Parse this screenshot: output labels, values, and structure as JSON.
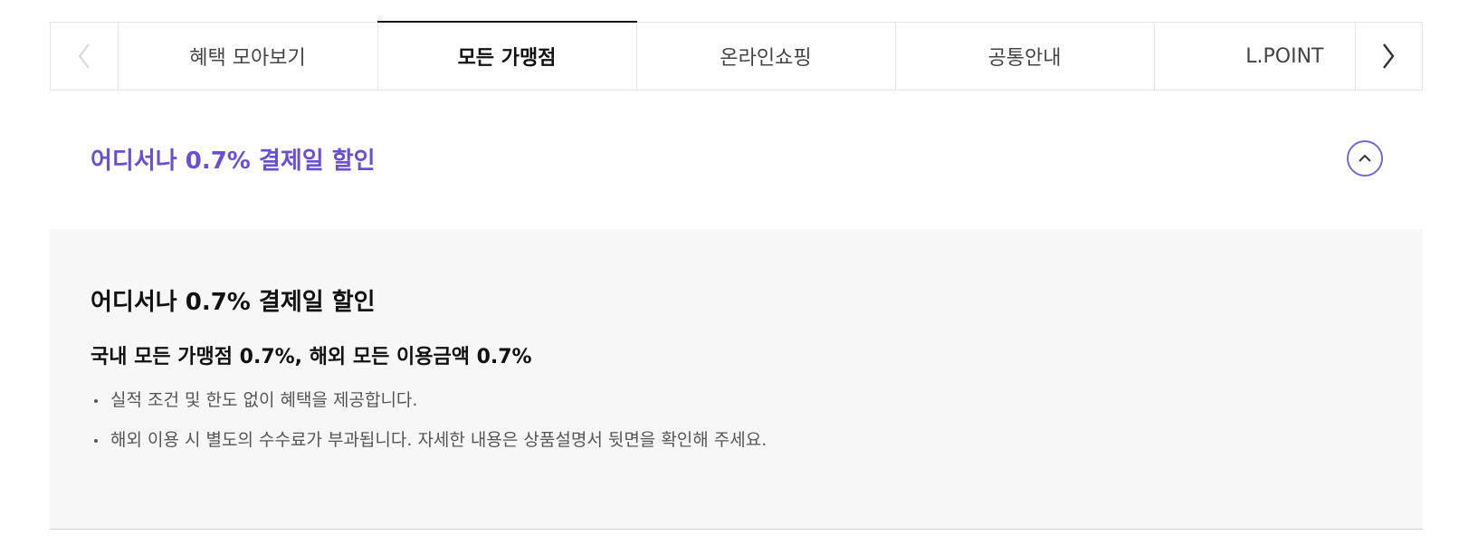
{
  "tabs": {
    "prev_icon": "chevron-left-icon",
    "next_icon": "chevron-right-icon",
    "items": [
      {
        "label": "혜택 모아보기",
        "active": false
      },
      {
        "label": "모든 가맹점",
        "active": true
      },
      {
        "label": "온라인쇼핑",
        "active": false
      },
      {
        "label": "공통안내",
        "active": false
      },
      {
        "label": "L.POINT",
        "active": false
      }
    ]
  },
  "accordion": {
    "title": "어디서나 0.7% 결제일 할인",
    "toggle_icon": "chevron-up-icon",
    "accent_color": "#6a4fd6",
    "expanded": true
  },
  "panel": {
    "title": "어디서나 0.7% 결제일 할인",
    "subtitle": "국내 모든 가맹점 0.7%, 해외 모든 이용금액 0.7%",
    "bullets": [
      "실적 조건 및 한도 없이 혜택을 제공합니다.",
      "해외 이용 시 별도의 수수료가 부과됩니다. 자세한 내용은 상품설명서 뒷면을 확인해 주세요."
    ]
  }
}
